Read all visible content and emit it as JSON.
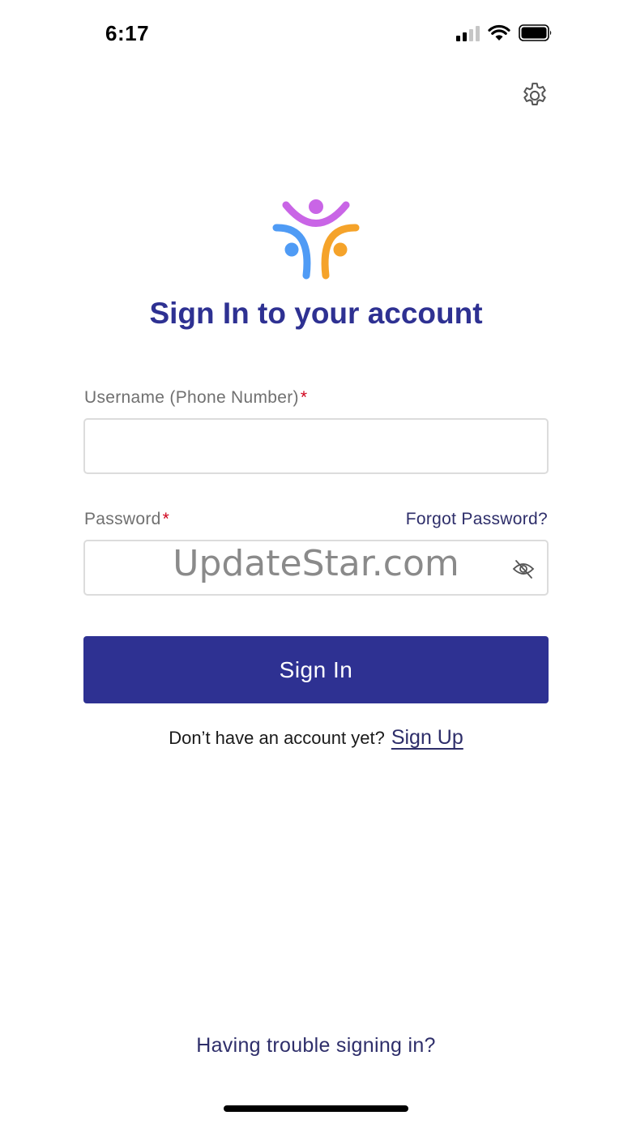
{
  "status_bar": {
    "time": "6:17",
    "signal_icon": "cellular-signal-icon",
    "wifi_icon": "wifi-icon",
    "battery_icon": "battery-icon"
  },
  "header": {
    "settings_icon": "gear-icon"
  },
  "brand": {
    "logo_icon": "people-logo-icon",
    "colors": {
      "purple": "#c965e6",
      "blue": "#4f9bf5",
      "orange": "#f5a32a"
    }
  },
  "title": "Sign In to your account",
  "form": {
    "username_label": "Username (Phone Number)",
    "password_label": "Password",
    "required_mark": "*",
    "forgot_password": "Forgot Password?",
    "username_value": "",
    "password_value": "",
    "visibility_icon": "eye-off-icon",
    "watermark": "UpdateStar.com"
  },
  "actions": {
    "sign_in": "Sign In",
    "signup_prompt": "Don’t have an account yet?",
    "signup_link": "Sign Up",
    "trouble": "Having trouble signing in?"
  },
  "colors": {
    "primary": "#2e3192",
    "link": "#2e2e6a",
    "required": "#d0021b",
    "label": "#707070",
    "input_border": "#dcdcdc"
  }
}
